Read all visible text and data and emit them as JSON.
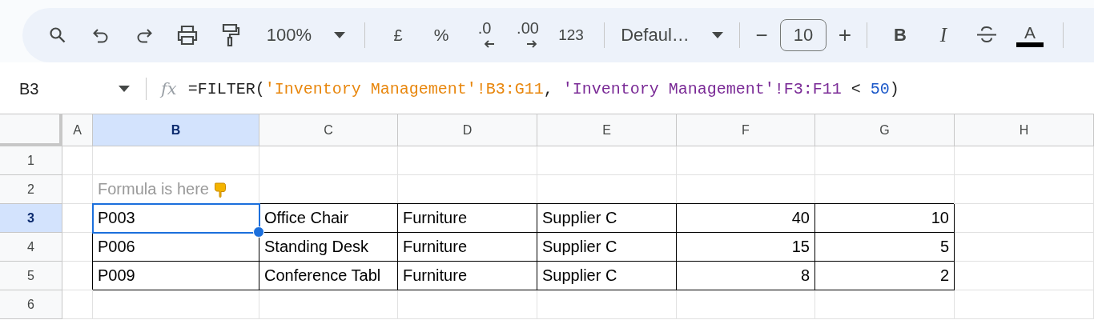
{
  "toolbar": {
    "zoom": "100%",
    "currency": "£",
    "percent": "%",
    "decrease_decimals": ".0",
    "increase_decimals": ".00",
    "number_format": "123",
    "font": "Defaul…",
    "size_minus": "−",
    "font_size": "10",
    "size_plus": "+",
    "bold": "B",
    "italic": "I",
    "text_color": "A"
  },
  "formula_bar": {
    "cell_reference": "B3",
    "function_label": "fx",
    "formula": [
      {
        "kind": "text",
        "text": "=FILTER("
      },
      {
        "kind": "reference",
        "text": "'Inventory Management'!B3:G11",
        "color": "#e8870e"
      },
      {
        "kind": "text",
        "text": ", "
      },
      {
        "kind": "reference",
        "text": "'Inventory Management'!F3:F11",
        "color": "#7a2a96"
      },
      {
        "kind": "text",
        "text": " < "
      },
      {
        "kind": "number",
        "text": "50"
      },
      {
        "kind": "text",
        "text": ")"
      }
    ]
  },
  "grid": {
    "columns": [
      {
        "label": "A",
        "selected": false
      },
      {
        "label": "B",
        "selected": true
      },
      {
        "label": "C",
        "selected": false
      },
      {
        "label": "D",
        "selected": false
      },
      {
        "label": "E",
        "selected": false
      },
      {
        "label": "F",
        "selected": false
      },
      {
        "label": "G",
        "selected": false
      },
      {
        "label": "H",
        "selected": false
      }
    ],
    "rows": [
      {
        "label": "1",
        "selected": false,
        "cells": []
      },
      {
        "label": "2",
        "selected": false,
        "cells": [
          {
            "kind": "empty",
            "text": ""
          },
          {
            "kind": "note",
            "text": "Formula is here"
          }
        ]
      },
      {
        "label": "3",
        "selected": true,
        "cells": [
          {
            "kind": "empty",
            "text": ""
          },
          {
            "kind": "text",
            "text": "P003",
            "bordered": true,
            "selected": true
          },
          {
            "kind": "text",
            "text": "Office Chair",
            "bordered": true,
            "selected": false
          },
          {
            "kind": "text",
            "text": "Furniture",
            "bordered": true,
            "selected": false
          },
          {
            "kind": "text",
            "text": "Supplier C",
            "bordered": true,
            "selected": false
          },
          {
            "kind": "number",
            "text": "40",
            "bordered": true,
            "selected": false
          },
          {
            "kind": "number",
            "text": "10",
            "bordered": true,
            "selected": false
          }
        ]
      },
      {
        "label": "4",
        "selected": false,
        "cells": [
          {
            "kind": "empty",
            "text": ""
          },
          {
            "kind": "text",
            "text": "P006",
            "bordered": true,
            "selected": false
          },
          {
            "kind": "text",
            "text": "Standing Desk",
            "bordered": true,
            "selected": false
          },
          {
            "kind": "text",
            "text": "Furniture",
            "bordered": true,
            "selected": false
          },
          {
            "kind": "text",
            "text": "Supplier C",
            "bordered": true,
            "selected": false
          },
          {
            "kind": "number",
            "text": "15",
            "bordered": true,
            "selected": false
          },
          {
            "kind": "number",
            "text": "5",
            "bordered": true,
            "selected": false
          }
        ]
      },
      {
        "label": "5",
        "selected": false,
        "cells": [
          {
            "kind": "empty",
            "text": ""
          },
          {
            "kind": "text",
            "text": "P009",
            "bordered": true,
            "selected": false
          },
          {
            "kind": "text",
            "text": "Conference Tabl",
            "bordered": true,
            "selected": false
          },
          {
            "kind": "text",
            "text": "Furniture",
            "bordered": true,
            "selected": false
          },
          {
            "kind": "text",
            "text": "Supplier C",
            "bordered": true,
            "selected": false
          },
          {
            "kind": "number",
            "text": "8",
            "bordered": true,
            "selected": false
          },
          {
            "kind": "number",
            "text": "2",
            "bordered": true,
            "selected": false
          }
        ]
      },
      {
        "label": "6",
        "selected": false,
        "cells": []
      }
    ]
  }
}
